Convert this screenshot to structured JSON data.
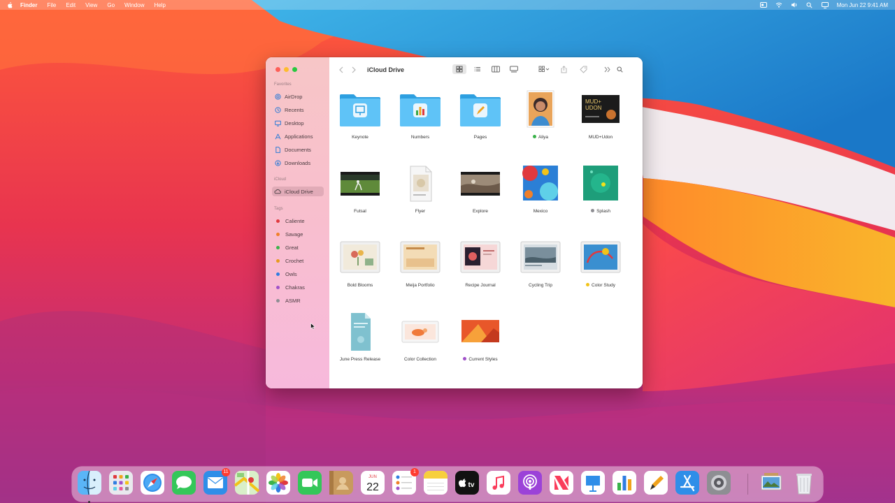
{
  "menubar": {
    "items": [
      "Finder",
      "File",
      "Edit",
      "View",
      "Go",
      "Window",
      "Help"
    ],
    "clock": "Mon Jun 22  9:41 AM"
  },
  "finder": {
    "title": "iCloud Drive",
    "sidebar": {
      "favorites_header": "Favorites",
      "favorites": [
        {
          "label": "AirDrop",
          "icon": "airdrop-icon"
        },
        {
          "label": "Recents",
          "icon": "clock-icon"
        },
        {
          "label": "Desktop",
          "icon": "desktop-icon"
        },
        {
          "label": "Applications",
          "icon": "applications-icon"
        },
        {
          "label": "Documents",
          "icon": "document-icon"
        },
        {
          "label": "Downloads",
          "icon": "download-icon"
        }
      ],
      "icloud_header": "iCloud",
      "icloud": [
        {
          "label": "iCloud Drive",
          "icon": "cloud-icon",
          "selected": true
        }
      ],
      "tags_header": "Tags",
      "tags": [
        {
          "label": "Caliente",
          "color": "#e0393e"
        },
        {
          "label": "Savage",
          "color": "#f0802a"
        },
        {
          "label": "Great",
          "color": "#3ab24a"
        },
        {
          "label": "Crochet",
          "color": "#e89a1c"
        },
        {
          "label": "Owls",
          "color": "#2f7de1"
        },
        {
          "label": "Chakras",
          "color": "#a051c9"
        },
        {
          "label": "ASMR",
          "color": "#8e8e93"
        }
      ]
    },
    "files": [
      {
        "label": "Keynote",
        "kind": "folder-keynote"
      },
      {
        "label": "Numbers",
        "kind": "folder-numbers"
      },
      {
        "label": "Pages",
        "kind": "folder-pages"
      },
      {
        "label": "Aliya",
        "kind": "photo-portrait",
        "tag": "#3ab24a"
      },
      {
        "label": "MUD+Udon",
        "kind": "photo-poster"
      },
      {
        "label": "Futsal",
        "kind": "video-futsal"
      },
      {
        "label": "Flyer",
        "kind": "doc-flyer"
      },
      {
        "label": "Explore",
        "kind": "video-explore"
      },
      {
        "label": "Mexico",
        "kind": "photo-mexico"
      },
      {
        "label": "Splash",
        "kind": "photo-splash",
        "tag": "#8e8e93"
      },
      {
        "label": "Bold Blooms",
        "kind": "keynote-blooms"
      },
      {
        "label": "Meija Portfolio",
        "kind": "keynote-portfolio"
      },
      {
        "label": "Recipe Journal",
        "kind": "keynote-recipe"
      },
      {
        "label": "Cycling Trip",
        "kind": "keynote-cycling"
      },
      {
        "label": "Color Study",
        "kind": "keynote-color",
        "tag": "#f2c318"
      },
      {
        "label": "June Press Release",
        "kind": "pages-press"
      },
      {
        "label": "Color Collection",
        "kind": "keynote-collection"
      },
      {
        "label": "Current Styles",
        "kind": "photo-styles",
        "tag": "#a051c9"
      }
    ]
  },
  "dock": {
    "apps": [
      {
        "name": "Finder",
        "icon": "finder-icon"
      },
      {
        "name": "Launchpad",
        "icon": "launchpad-icon"
      },
      {
        "name": "Safari",
        "icon": "safari-icon"
      },
      {
        "name": "Messages",
        "icon": "messages-icon"
      },
      {
        "name": "Mail",
        "icon": "mail-icon",
        "badge": "11"
      },
      {
        "name": "Maps",
        "icon": "maps-icon"
      },
      {
        "name": "Photos",
        "icon": "photos-icon"
      },
      {
        "name": "FaceTime",
        "icon": "facetime-icon"
      },
      {
        "name": "Contacts",
        "icon": "contacts-icon"
      },
      {
        "name": "Calendar",
        "icon": "calendar-icon",
        "month": "JUN",
        "day": "22"
      },
      {
        "name": "Reminders",
        "icon": "reminders-icon",
        "badge": "1"
      },
      {
        "name": "Notes",
        "icon": "notes-icon"
      },
      {
        "name": "TV",
        "icon": "tv-icon",
        "text": "tv"
      },
      {
        "name": "Music",
        "icon": "music-icon"
      },
      {
        "name": "Podcasts",
        "icon": "podcasts-icon"
      },
      {
        "name": "News",
        "icon": "news-icon"
      },
      {
        "name": "Keynote",
        "icon": "keynote-icon"
      },
      {
        "name": "Numbers",
        "icon": "numbers-icon"
      },
      {
        "name": "Pages",
        "icon": "pages-icon"
      },
      {
        "name": "App Store",
        "icon": "app-store-icon"
      },
      {
        "name": "System Preferences",
        "icon": "system-preferences-icon"
      },
      {
        "name": "Preview",
        "icon": "preview-icon"
      },
      {
        "name": "Trash",
        "icon": "trash-icon"
      }
    ]
  }
}
